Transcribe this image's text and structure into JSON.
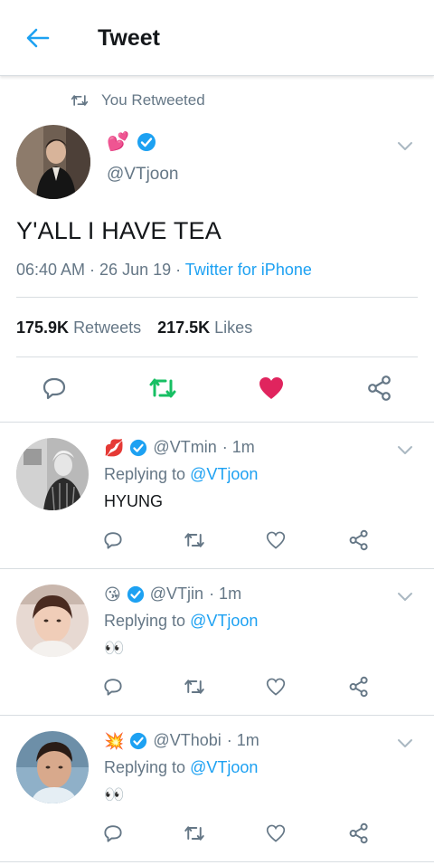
{
  "header": {
    "title": "Tweet"
  },
  "retweet_note": "You Retweeted",
  "main_tweet": {
    "name_emoji": "💕",
    "handle": "@VTjoon",
    "text": "Y'ALL I HAVE TEA",
    "time": "06:40 AM · 26 Jun 19 · ",
    "source": "Twitter for iPhone",
    "retweets_count": "175.9K",
    "retweets_label": "Retweets",
    "likes_count": "217.5K",
    "likes_label": "Likes",
    "liked": true,
    "retweeted": true
  },
  "replies": [
    {
      "emoji": "💋",
      "handle": "@VTmin",
      "time": "· 1m",
      "replying_prefix": "Replying to",
      "replying_to": "@VTjoon",
      "text": "HYUNG"
    },
    {
      "emoji": "😘",
      "handle": "@VTjin",
      "time": "· 1m",
      "replying_prefix": "Replying to",
      "replying_to": "@VTjoon",
      "text": "👀"
    },
    {
      "emoji": "💥",
      "handle": "@VThobi",
      "time": "· 1m",
      "replying_prefix": "Replying to",
      "replying_to": "@VTjoon",
      "text": "👀"
    }
  ],
  "colors": {
    "accent": "#1da1f2",
    "retweet": "#17bf63",
    "like": "#e0245e",
    "muted": "#657786",
    "text": "#14171a"
  },
  "icons": [
    "back-arrow-icon",
    "retweet-icon",
    "verified-badge-icon",
    "chevron-down-icon",
    "reply-icon",
    "heart-icon",
    "share-icon"
  ]
}
